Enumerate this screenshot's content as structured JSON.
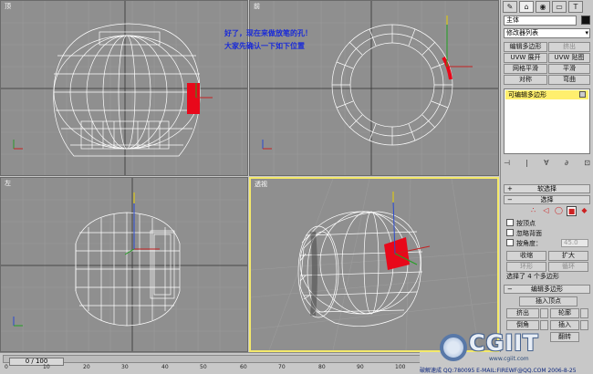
{
  "viewports": {
    "top": {
      "label": "顶"
    },
    "front": {
      "label": "前"
    },
    "left": {
      "label": "左"
    },
    "perspective": {
      "label": "透视"
    }
  },
  "note": {
    "line1": "好了，现在来做放笔的孔！",
    "line2": "大家先确认一下如下位置"
  },
  "command_panel": {
    "tabs": [
      "✎",
      "⌂",
      "◉",
      "▭",
      "T"
    ],
    "object_name": "主体",
    "modifier_list": "修改器列表",
    "buttons": [
      {
        "label": "编辑多边形",
        "disabled": false
      },
      {
        "label": "挤出",
        "disabled": true
      },
      {
        "label": "UVW 展开",
        "disabled": false
      },
      {
        "label": "UVW 贴图",
        "disabled": false
      },
      {
        "label": "网格平滑",
        "disabled": false
      },
      {
        "label": "平滑",
        "disabled": false
      },
      {
        "label": "对称",
        "disabled": false
      },
      {
        "label": "弯曲",
        "disabled": false
      }
    ],
    "stack_item": "可编辑多边形",
    "stack_tools": [
      "⊣",
      "|",
      "∀",
      "∂",
      "⊡"
    ],
    "rollouts": {
      "soft_selection": "软选择",
      "selection": "选择",
      "edit_polygons": "编辑多边形"
    },
    "selection": {
      "by_vertex": "按顶点",
      "ignore_backfacing": "忽略背面",
      "by_angle": "按角度：",
      "angle_value": "45.0",
      "shrink": "收缩",
      "grow": "扩大",
      "ring": "环形",
      "loop": "循环",
      "status": "选择了 4 个多边形"
    },
    "edit_polygons": {
      "insert_vertex": "插入顶点",
      "extrude": "挤出",
      "outline": "轮廓",
      "bevel": "倒角",
      "inset": "插入",
      "flip": "翻转"
    }
  },
  "timeline": {
    "frame": "0 / 100",
    "ticks": [
      "0",
      "10",
      "20",
      "30",
      "40",
      "50",
      "60",
      "70",
      "80",
      "90",
      "100"
    ]
  },
  "footer": {
    "credit": "破解速成 QQ:780095 E-MAIL:FIREWF@QQ.COM 2006-8-25",
    "logo": "CGIIT",
    "logo_sub": "www.cgiit.com"
  },
  "colors": {
    "viewport_bg": "#8f8f8f",
    "active_border": "#f4e96a",
    "selection_red": "#e8081a",
    "note_blue": "#1a2bd8",
    "stack_yellow": "#ffef6e"
  }
}
